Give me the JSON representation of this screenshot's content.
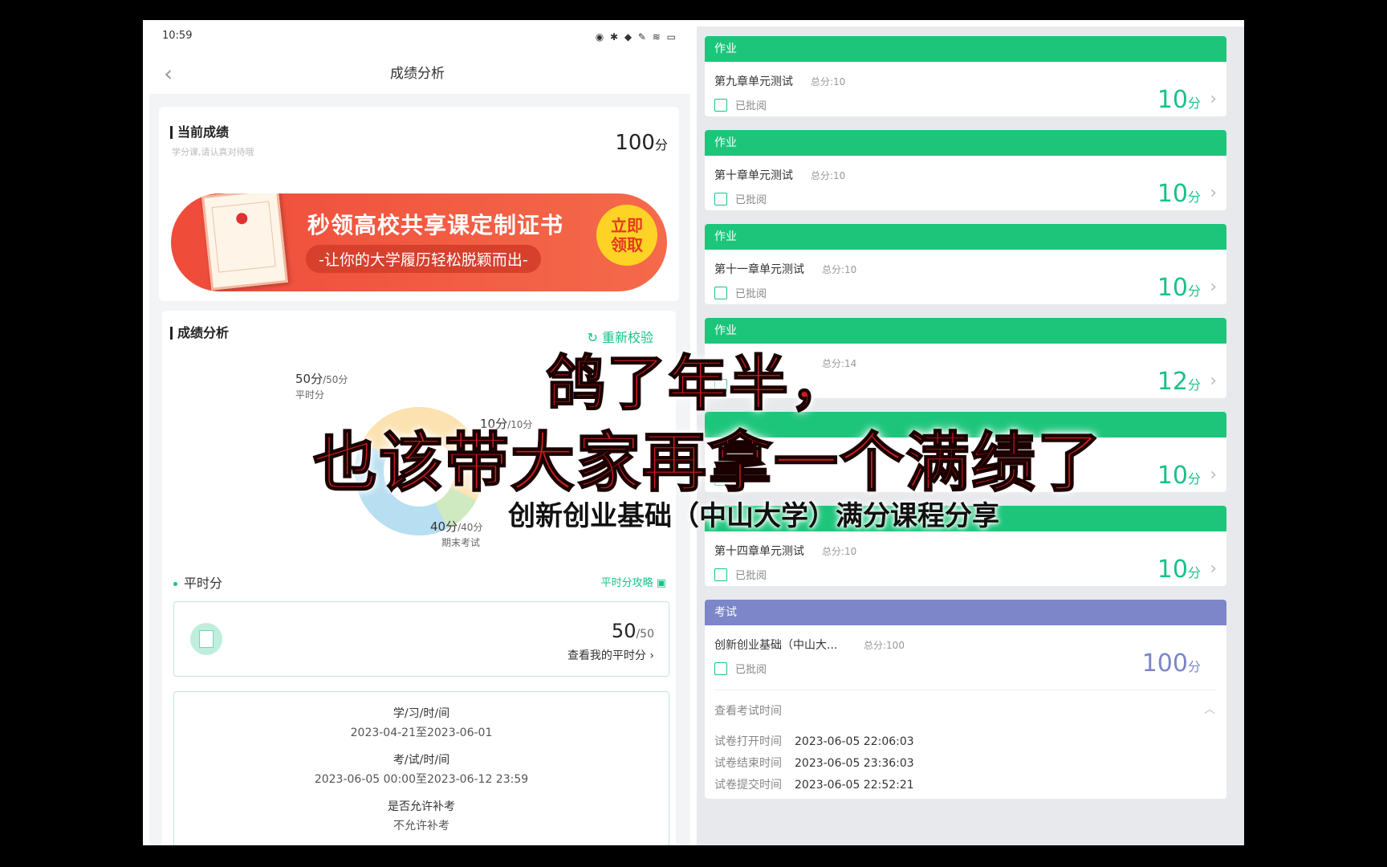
{
  "status": {
    "time": "10:59",
    "icons": "◉ ✱ ◆ ✎ ≋ ▭"
  },
  "left": {
    "title": "成绩分析",
    "current_score": {
      "title": "当前成绩",
      "hint": "学分课,请认真对待哦",
      "value": "100",
      "unit": "分"
    },
    "banner": {
      "main": "秒领高校共享课定制证书",
      "sub": "-让你的大学履历轻松脱颖而出-",
      "button_line1": "立即",
      "button_line2": "领取"
    },
    "analysis": {
      "title": "成绩分析",
      "recheck": "重新校验",
      "segments": [
        {
          "score": "50分",
          "max": "/50分",
          "label": "平时分",
          "value": 50,
          "color": "#fbe2b0"
        },
        {
          "score": "10分",
          "max": "/10分",
          "label": "",
          "value": 10,
          "color": "#cfe9c0"
        },
        {
          "score": "40分",
          "max": "/40分",
          "label": "期末考试",
          "value": 40,
          "color": "#b7def1"
        }
      ]
    },
    "ordinary": {
      "label": "平时分",
      "strategy": "平时分攻略",
      "score": "50",
      "max": "/50",
      "link": "查看我的平时分"
    },
    "info": [
      {
        "title": "学/习/时/间",
        "value": "2023-04-21至2023-06-01"
      },
      {
        "title": "考/试/时/间",
        "value": "2023-06-05 00:00至2023-06-12 23:59"
      },
      {
        "title": "是否允许补考",
        "value": "不允许补考"
      }
    ]
  },
  "right": {
    "items": [
      {
        "type": "作业",
        "name": "第九章单元测试",
        "total": "总分:10",
        "status": "已批阅",
        "score": "10",
        "unit": "分"
      },
      {
        "type": "作业",
        "name": "第十章单元测试",
        "total": "总分:10",
        "status": "已批阅",
        "score": "10",
        "unit": "分"
      },
      {
        "type": "作业",
        "name": "第十一章单元测试",
        "total": "总分:10",
        "status": "已批阅",
        "score": "10",
        "unit": "分"
      },
      {
        "type": "作业",
        "name": "",
        "total": "总分:14",
        "status": "",
        "score": "12",
        "unit": "分"
      },
      {
        "type": "",
        "name": "",
        "total": "",
        "status": "",
        "score": "10",
        "unit": "分"
      },
      {
        "type": "",
        "name": "第十四章单元测试",
        "total": "总分:10",
        "status": "已批阅",
        "score": "10",
        "unit": "分"
      }
    ],
    "exam": {
      "type": "考试",
      "name": "创新创业基础（中山大...",
      "total": "总分:100",
      "status": "已批阅",
      "score": "100",
      "unit": "分",
      "time_title": "查看考试时间",
      "times": [
        {
          "label": "试卷打开时间",
          "value": "2023-06-05 22:06:03"
        },
        {
          "label": "试卷结束时间",
          "value": "2023-06-05 23:36:03"
        },
        {
          "label": "试卷提交时间",
          "value": "2023-06-05 22:52:21"
        }
      ]
    }
  },
  "overlay": {
    "line1": "鸽了年半，",
    "line2": "也该带大家再拿一个满绩了",
    "subtitle": "创新创业基础（中山大学）满分课程分享"
  }
}
